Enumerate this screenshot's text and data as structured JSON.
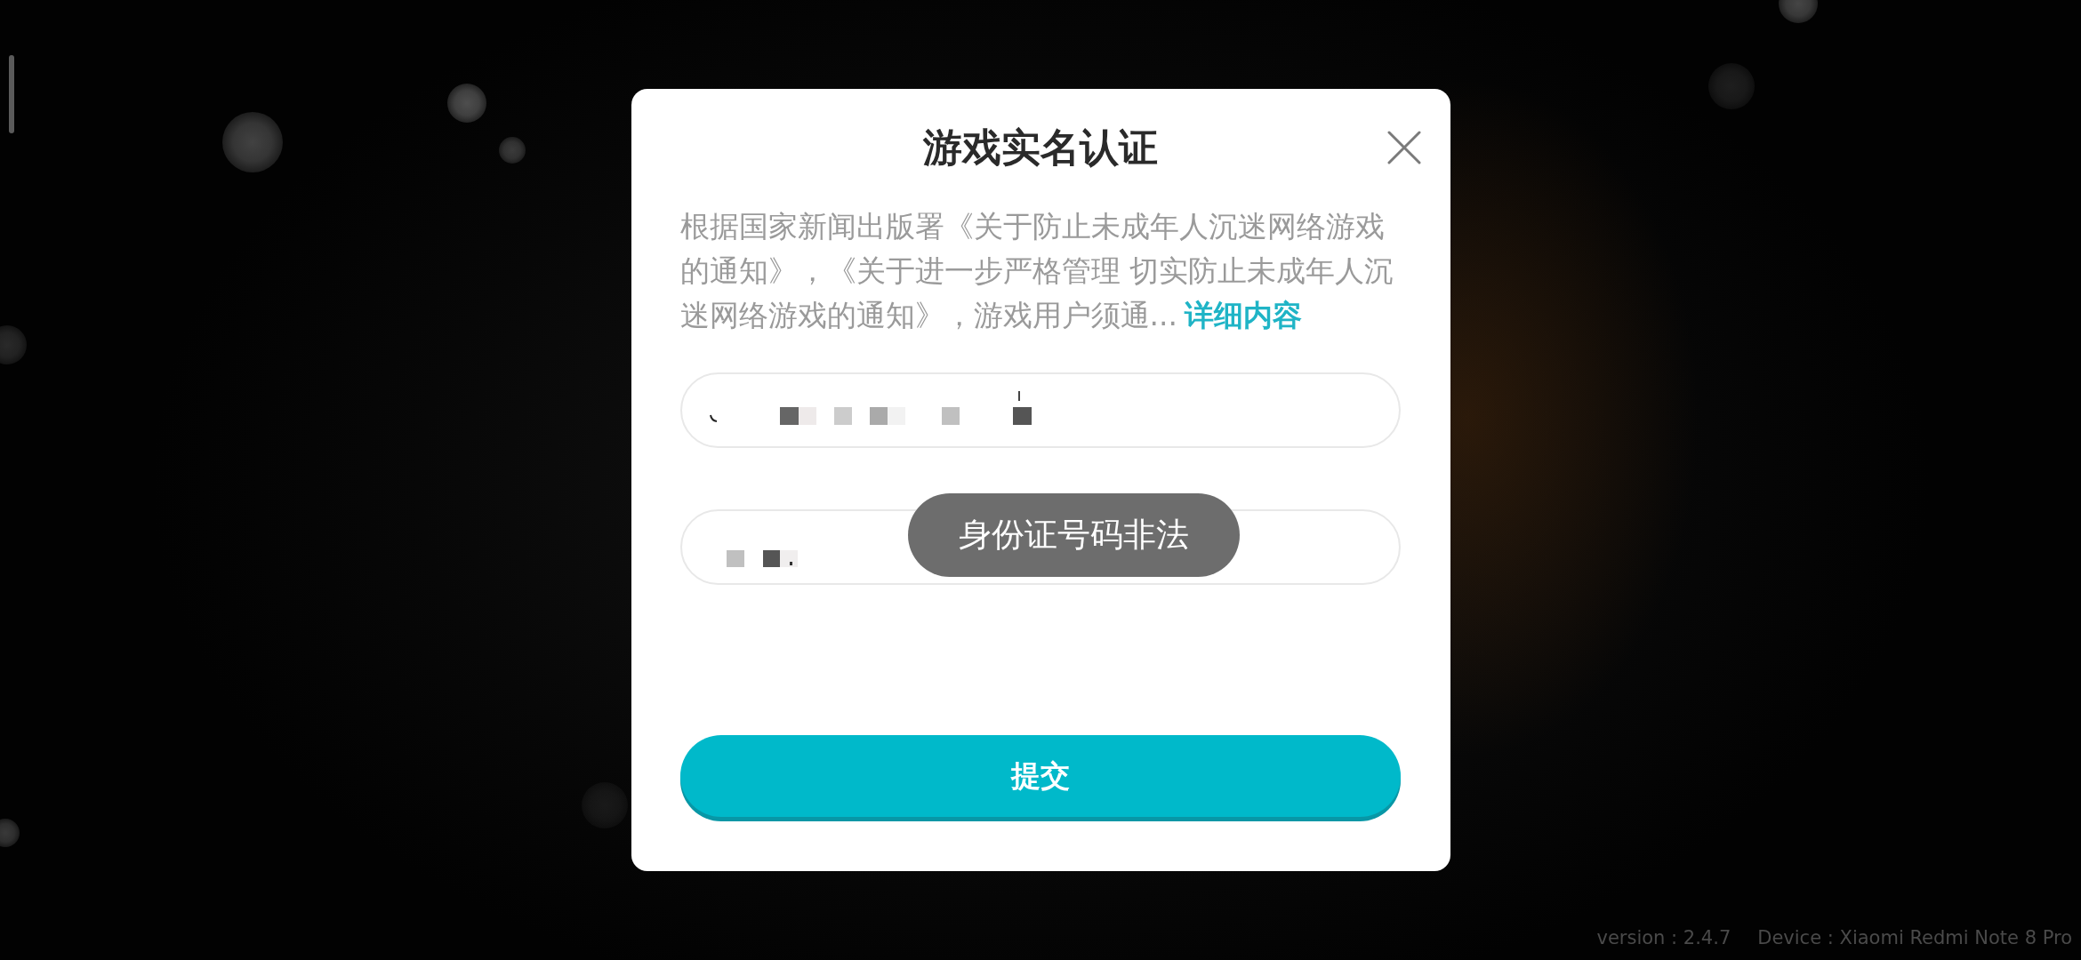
{
  "dialog": {
    "title": "游戏实名认证",
    "notice": {
      "text": "根据国家新闻出版署《关于防止未成年人沉迷网络游戏的通知》，《关于进一步严格管理 切实防止未成年人沉迷网络游戏的通知》，游戏用户须通...",
      "link": "详细内容"
    },
    "fields": [
      {
        "redacted": true
      },
      {
        "redacted": true
      }
    ],
    "submit_button": "提交"
  },
  "toast": {
    "text": "身份证号码非法"
  },
  "footer": {
    "version": "version : 2.4.7",
    "device": "Device : Xiaomi Redmi Note 8 Pro"
  }
}
